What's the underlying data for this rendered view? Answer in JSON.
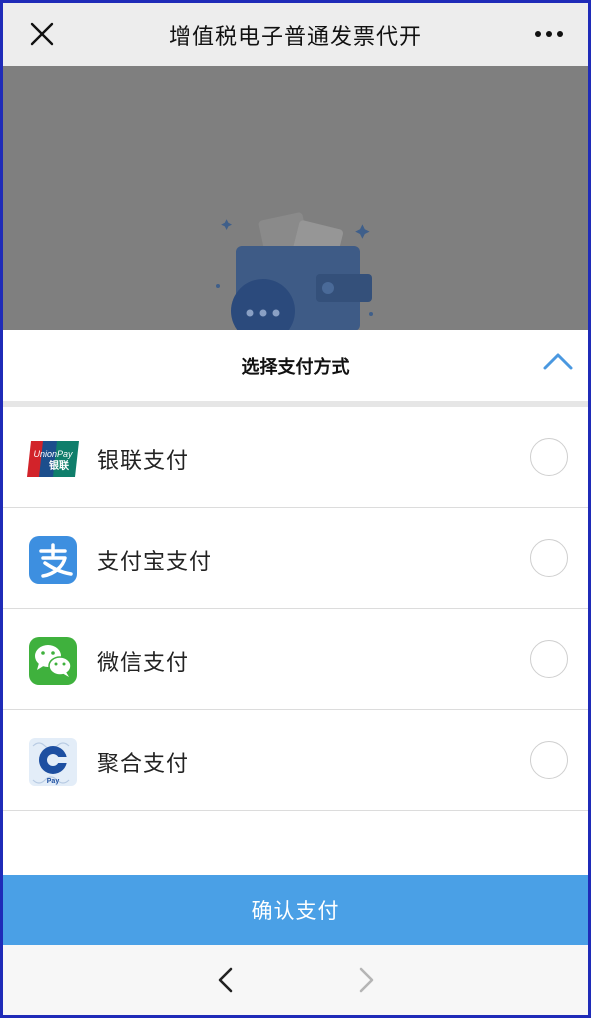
{
  "navbar": {
    "title": "增值税电子普通发票代开",
    "close_icon": "close-icon",
    "more_icon": "more-dots-icon"
  },
  "backdrop": {
    "illustration": "wallet-icon"
  },
  "sheet": {
    "title": "选择支付方式",
    "collapse_icon": "chevron-up-icon"
  },
  "payment_options": [
    {
      "label": "银联支付",
      "icon": "unionpay-icon",
      "selected": false
    },
    {
      "label": "支付宝支付",
      "icon": "alipay-icon",
      "selected": false
    },
    {
      "label": "微信支付",
      "icon": "wechat-pay-icon",
      "selected": false
    },
    {
      "label": "聚合支付",
      "icon": "ccb-pay-icon",
      "selected": false
    }
  ],
  "unionpay_logo_text": "UnionPay 银联",
  "ccb_logo_text": "Pay",
  "confirm_button": {
    "label": "确认支付"
  },
  "browser_nav": {
    "back_icon": "chevron-left-icon",
    "forward_icon": "chevron-right-icon"
  },
  "colors": {
    "accent": "#4aa0e6",
    "wechat_green": "#3fb13d",
    "alipay_blue": "#3d8fe0",
    "unionpay_red": "#d2232a",
    "frame_border": "#1f2bb8"
  }
}
